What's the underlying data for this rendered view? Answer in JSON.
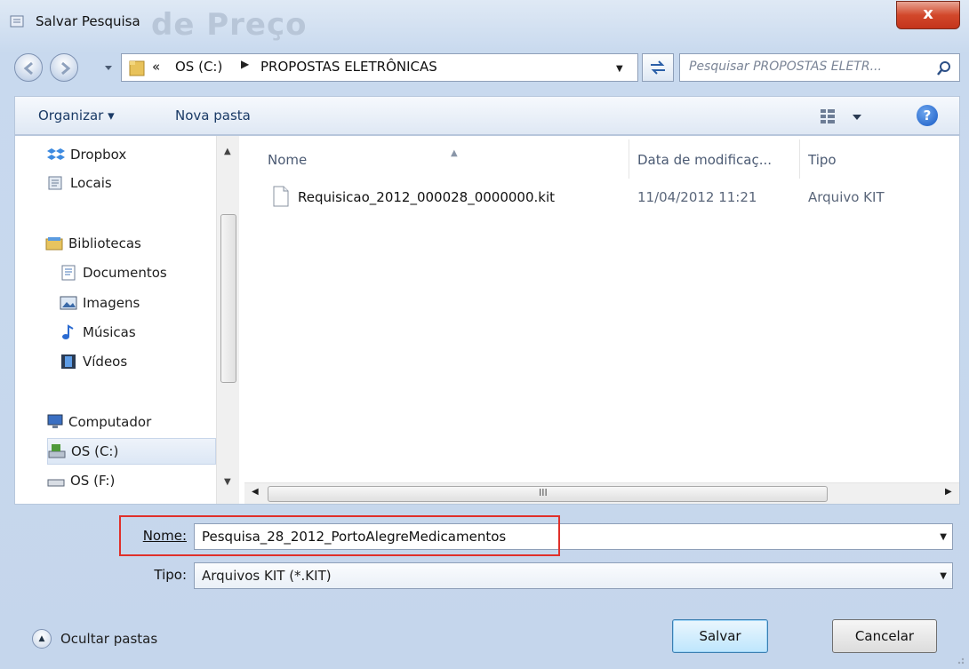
{
  "window": {
    "title": "Salvar Pesquisa",
    "background_text": "de Preço",
    "close_label": "x"
  },
  "address": {
    "overflow": "«",
    "drive": "OS (C:)",
    "folder": "PROPOSTAS ELETRÔNICAS",
    "search_placeholder": "Pesquisar PROPOSTAS ELETR..."
  },
  "toolbar": {
    "organize": "Organizar ▾",
    "new_folder": "Nova pasta",
    "help": "?"
  },
  "nav": {
    "dropbox": "Dropbox",
    "locais": "Locais",
    "bibliotecas": "Bibliotecas",
    "documentos": "Documentos",
    "imagens": "Imagens",
    "musicas": "Músicas",
    "videos": "Vídeos",
    "computador": "Computador",
    "os_c": "OS (C:)",
    "os_f": "OS (F:)"
  },
  "files": {
    "columns": {
      "name": "Nome",
      "date": "Data de modificaç...",
      "type": "Tipo"
    },
    "rows": [
      {
        "name": "Requisicao_2012_000028_0000000.kit",
        "date": "11/04/2012 11:21",
        "type": "Arquivo KIT"
      }
    ],
    "scroll_grip": "III"
  },
  "form": {
    "name_label": "Nome:",
    "name_value": "Pesquisa_28_2012_PortoAlegreMedicamentos",
    "type_label": "Tipo:",
    "type_value": "Arquivos KIT (*.KIT)"
  },
  "footer": {
    "hide_folders": "Ocultar pastas",
    "save": "Salvar",
    "cancel": "Cancelar"
  },
  "colors": {
    "highlight": "#e0302a",
    "accent": "#1a3a66",
    "close": "#c4341b"
  }
}
